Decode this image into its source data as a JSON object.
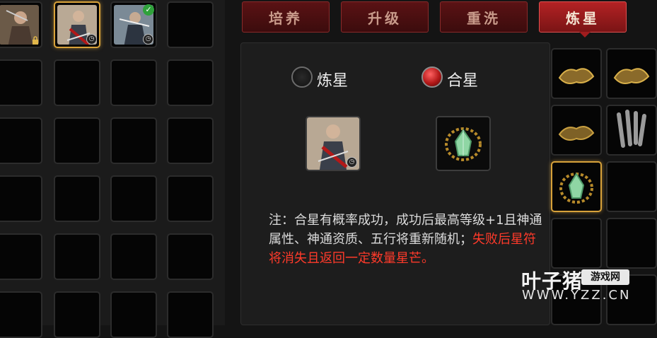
{
  "tabs": [
    {
      "label": "培养",
      "active": false
    },
    {
      "label": "升级",
      "active": false
    },
    {
      "label": "重洗",
      "active": false
    },
    {
      "label": "炼星",
      "active": true
    }
  ],
  "mode": {
    "options": [
      {
        "label": "炼星",
        "selected": false
      },
      {
        "label": "合星",
        "selected": true
      }
    ]
  },
  "note": {
    "text": "注：合星有概率成功，成功后最高等级+1且神通属性、神通资质、五行将重新随机；",
    "warning": "失败后星符将消失且返回一定数量星芒。"
  },
  "watermark": {
    "name": "叶子猪",
    "tag": "游戏网",
    "url": "WWW.YZZ.CN"
  },
  "colors": {
    "active_tab": "#b42224",
    "inactive_tab": "#4a0f10",
    "warning_text": "#ff3a2a",
    "selected_border": "#d8a23a"
  }
}
